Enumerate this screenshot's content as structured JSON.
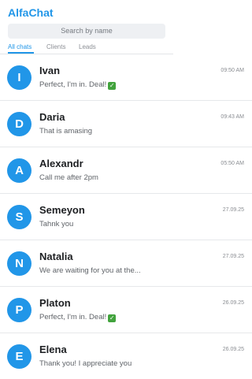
{
  "app": {
    "title": "AlfaChat"
  },
  "search": {
    "placeholder": "Search by name"
  },
  "tabs": [
    {
      "label": "All chats",
      "active": true
    },
    {
      "label": "Clients",
      "active": false
    },
    {
      "label": "Leads",
      "active": false
    }
  ],
  "chats": [
    {
      "initial": "I",
      "name": "Ivan",
      "time": "09:50 AM",
      "message": "Perfect, I'm in. Deal!",
      "check_icon": "check-mark-button-icon"
    },
    {
      "initial": "D",
      "name": "Daria",
      "time": "09:43 AM",
      "message": "That is amasing"
    },
    {
      "initial": "A",
      "name": "Alexandr",
      "time": "05:50 AM",
      "message": "Call me after 2pm"
    },
    {
      "initial": "S",
      "name": "Semeyon",
      "time": "27.09.25",
      "message": "Tahnk you"
    },
    {
      "initial": "N",
      "name": "Natalia",
      "time": "27.09.25",
      "message": "We are waiting for you at the..."
    },
    {
      "initial": "P",
      "name": "Platon",
      "time": "26.09.25",
      "message": "Perfect, I'm in. Deal!",
      "check_icon": "check-mark-button-icon"
    },
    {
      "initial": "E",
      "name": "Elena",
      "time": "26.09.25",
      "message": "Thank you! I appreciate you"
    }
  ],
  "colors": {
    "accent": "#2196e8",
    "check": "#42a33d"
  }
}
